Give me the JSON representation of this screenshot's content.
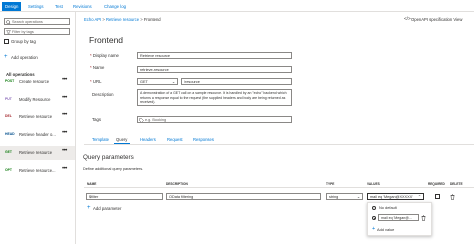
{
  "tabs": [
    "Design",
    "Settings",
    "Test",
    "Revisions",
    "Change log"
  ],
  "sidebar": {
    "search_placeholder": "Search operations",
    "filter_placeholder": "Filter by tags",
    "group_by_tag": "Group by tag",
    "add_operation": "Add operation",
    "section_title": "All operations",
    "items": [
      {
        "verb": "POST",
        "name": "Create resource",
        "color": "#107c10"
      },
      {
        "verb": "PUT",
        "name": "Modify Resource",
        "color": "#8764b8"
      },
      {
        "verb": "DEL",
        "name": "Retrieve resource",
        "color": "#a4262c"
      },
      {
        "verb": "HEAD",
        "name": "Retrieve header o...",
        "color": "#004e8c"
      },
      {
        "verb": "GET",
        "name": "Retrieve resource",
        "color": "#107c10"
      },
      {
        "verb": "OPT",
        "name": "Retrieve resource...",
        "color": "#107c10"
      }
    ]
  },
  "breadcrumb": [
    "Echo API",
    "Retrieve resource",
    "Frontend"
  ],
  "openapi_link": "OpenAPI specification View",
  "main": {
    "title": "Frontend",
    "display_name_label": "Display name",
    "display_name_value": "Retrieve resource",
    "name_label": "Name",
    "name_value": "retrieve-resource",
    "url_label": "URL",
    "url_method": "GET",
    "url_path": "/resource",
    "description_label": "Description",
    "description_value": "A demonstration of a GET call on a sample resource. It is handled by an \"echo\" backend which returns a response equal to the request (the supplied headers and body are being returned as received).",
    "tags_label": "Tags",
    "tags_placeholder": "e.g. Booking"
  },
  "subtabs": [
    "Template",
    "Query",
    "Headers",
    "Request",
    "Responses"
  ],
  "query": {
    "title": "Query parameters",
    "subtitle": "Define additional query parameters.",
    "headers": [
      "NAME",
      "DESCRIPTION",
      "TYPE",
      "VALUES",
      "REQUIRED",
      "DELETE"
    ],
    "row": {
      "name": "$filter",
      "description": "OData filtering",
      "type": "string",
      "values": "mail eq 'Megan@XXXXX'"
    },
    "add_parameter": "Add parameter",
    "dropdown": {
      "no_default": "No default",
      "option_value": "mail eq 'Megan@...",
      "add_value": "Add value"
    }
  }
}
